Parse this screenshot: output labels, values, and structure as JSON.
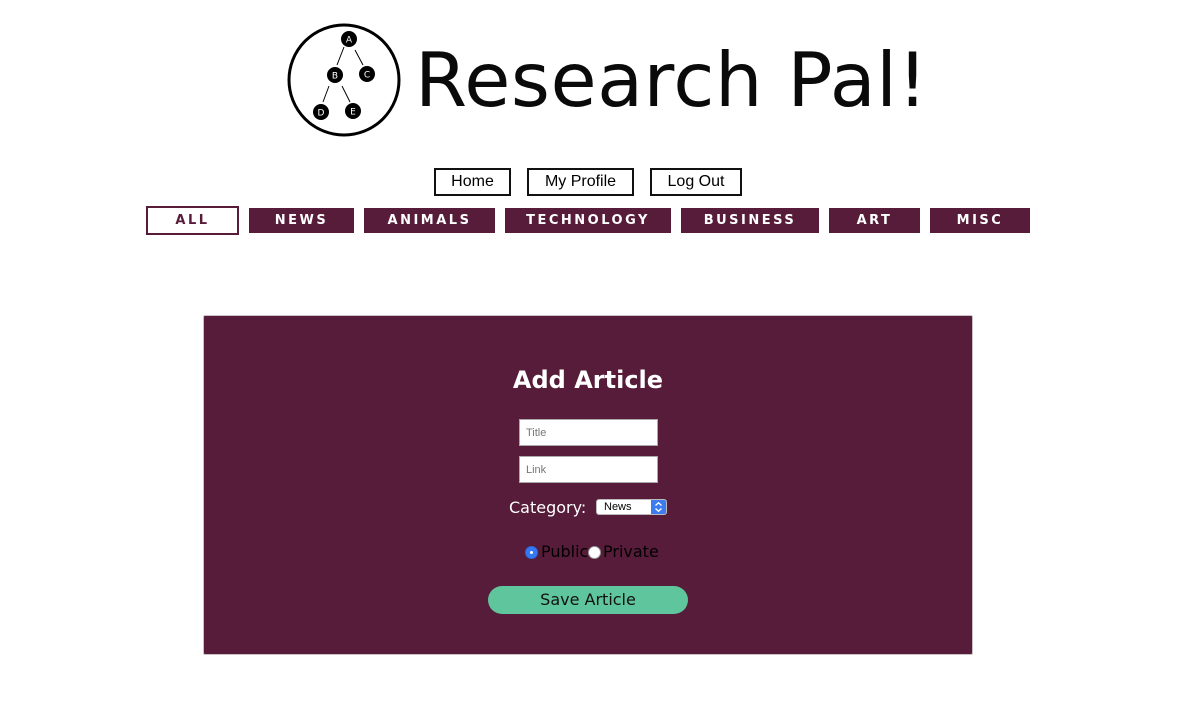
{
  "logo": {
    "text": "Research Pal!",
    "nodes": [
      "A",
      "B",
      "C",
      "D",
      "E"
    ]
  },
  "nav": {
    "home": "Home",
    "profile": "My Profile",
    "logout": "Log Out"
  },
  "categories": [
    {
      "label": "ALL",
      "active": true
    },
    {
      "label": "NEWS",
      "active": false
    },
    {
      "label": "ANIMALS",
      "active": false
    },
    {
      "label": "TECHNOLOGY",
      "active": false
    },
    {
      "label": "BUSINESS",
      "active": false
    },
    {
      "label": "ART",
      "active": false
    },
    {
      "label": "MISC",
      "active": false
    }
  ],
  "form": {
    "title": "Add Article",
    "title_placeholder": "Title",
    "link_placeholder": "Link",
    "category_label": "Category:",
    "category_value": "News",
    "public_label": "Public",
    "private_label": "Private",
    "visibility": "Public",
    "save_label": "Save Article"
  },
  "colors": {
    "brand": "#561c3a",
    "save_button": "#5ec59c",
    "radio_selected": "#3478f6"
  }
}
